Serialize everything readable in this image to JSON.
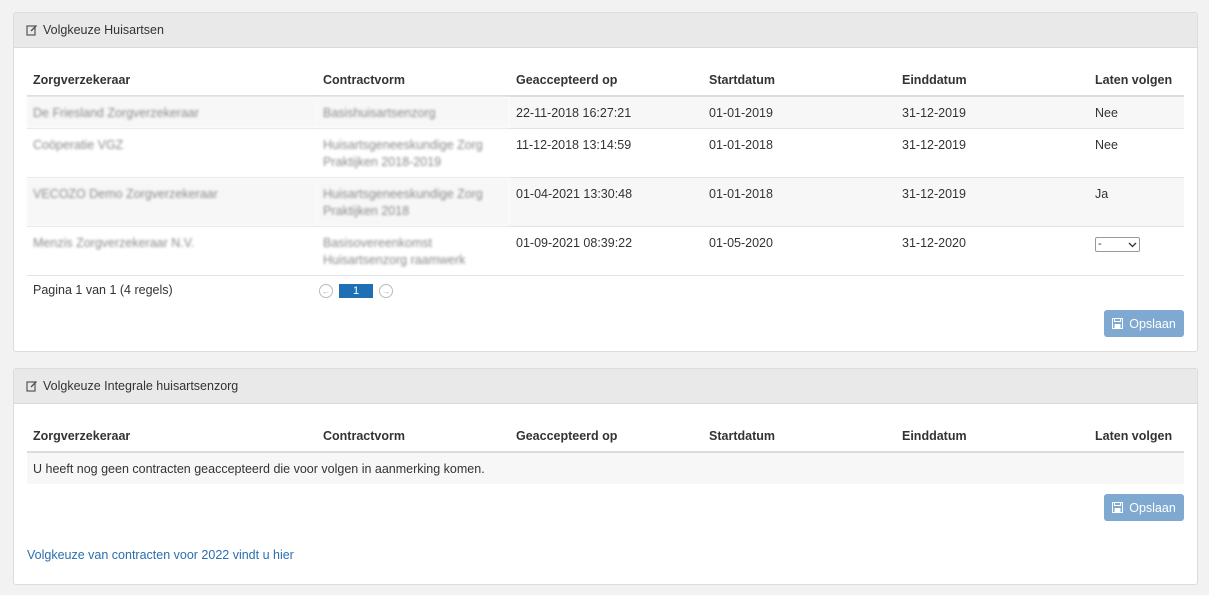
{
  "panel1": {
    "title": "Volgkeuze Huisartsen",
    "columns": [
      "Zorgverzekeraar",
      "Contractvorm",
      "Geaccepteerd op",
      "Startdatum",
      "Einddatum",
      "Laten volgen"
    ],
    "rows": [
      {
        "insurer": "De Friesland Zorgverzekeraar",
        "contract": "Basishuisartsenzorg",
        "accepted": "22-11-2018 16:27:21",
        "start": "01-01-2019",
        "end": "31-12-2019",
        "follow": "Nee"
      },
      {
        "insurer": "Coöperatie VGZ",
        "contract": "Huisartsgeneeskundige Zorg Praktijken 2018-2019",
        "accepted": "11-12-2018 13:14:59",
        "start": "01-01-2018",
        "end": "31-12-2019",
        "follow": "Nee"
      },
      {
        "insurer": "VECOZO Demo Zorgverzekeraar",
        "contract": "Huisartsgeneeskundige Zorg Praktijken 2018",
        "accepted": "01-04-2021 13:30:48",
        "start": "01-01-2018",
        "end": "31-12-2019",
        "follow": "Ja"
      },
      {
        "insurer": "Menzis Zorgverzekeraar N.V.",
        "contract": "Basisovereenkomst Huisartsenzorg raamwerk",
        "accepted": "01-09-2021 08:39:22",
        "start": "01-05-2020",
        "end": "31-12-2020",
        "follow": "-"
      }
    ],
    "pagination_info": "Pagina 1 van 1 (4 regels)",
    "current_page": "1",
    "save_label": "Opslaan"
  },
  "panel2": {
    "title": "Volgkeuze Integrale huisartsenzorg",
    "columns": [
      "Zorgverzekeraar",
      "Contractvorm",
      "Geaccepteerd op",
      "Startdatum",
      "Einddatum",
      "Laten volgen"
    ],
    "empty_message": "U heeft nog geen contracten geaccepteerd die voor volgen in aanmerking komen.",
    "save_label": "Opslaan",
    "link_text": "Volgkeuze van contracten voor 2022 vindt u hier"
  },
  "colors": {
    "primary": "#1f6fb5",
    "button_disabled": "#7fa9d1",
    "link": "#2a6fb0"
  }
}
